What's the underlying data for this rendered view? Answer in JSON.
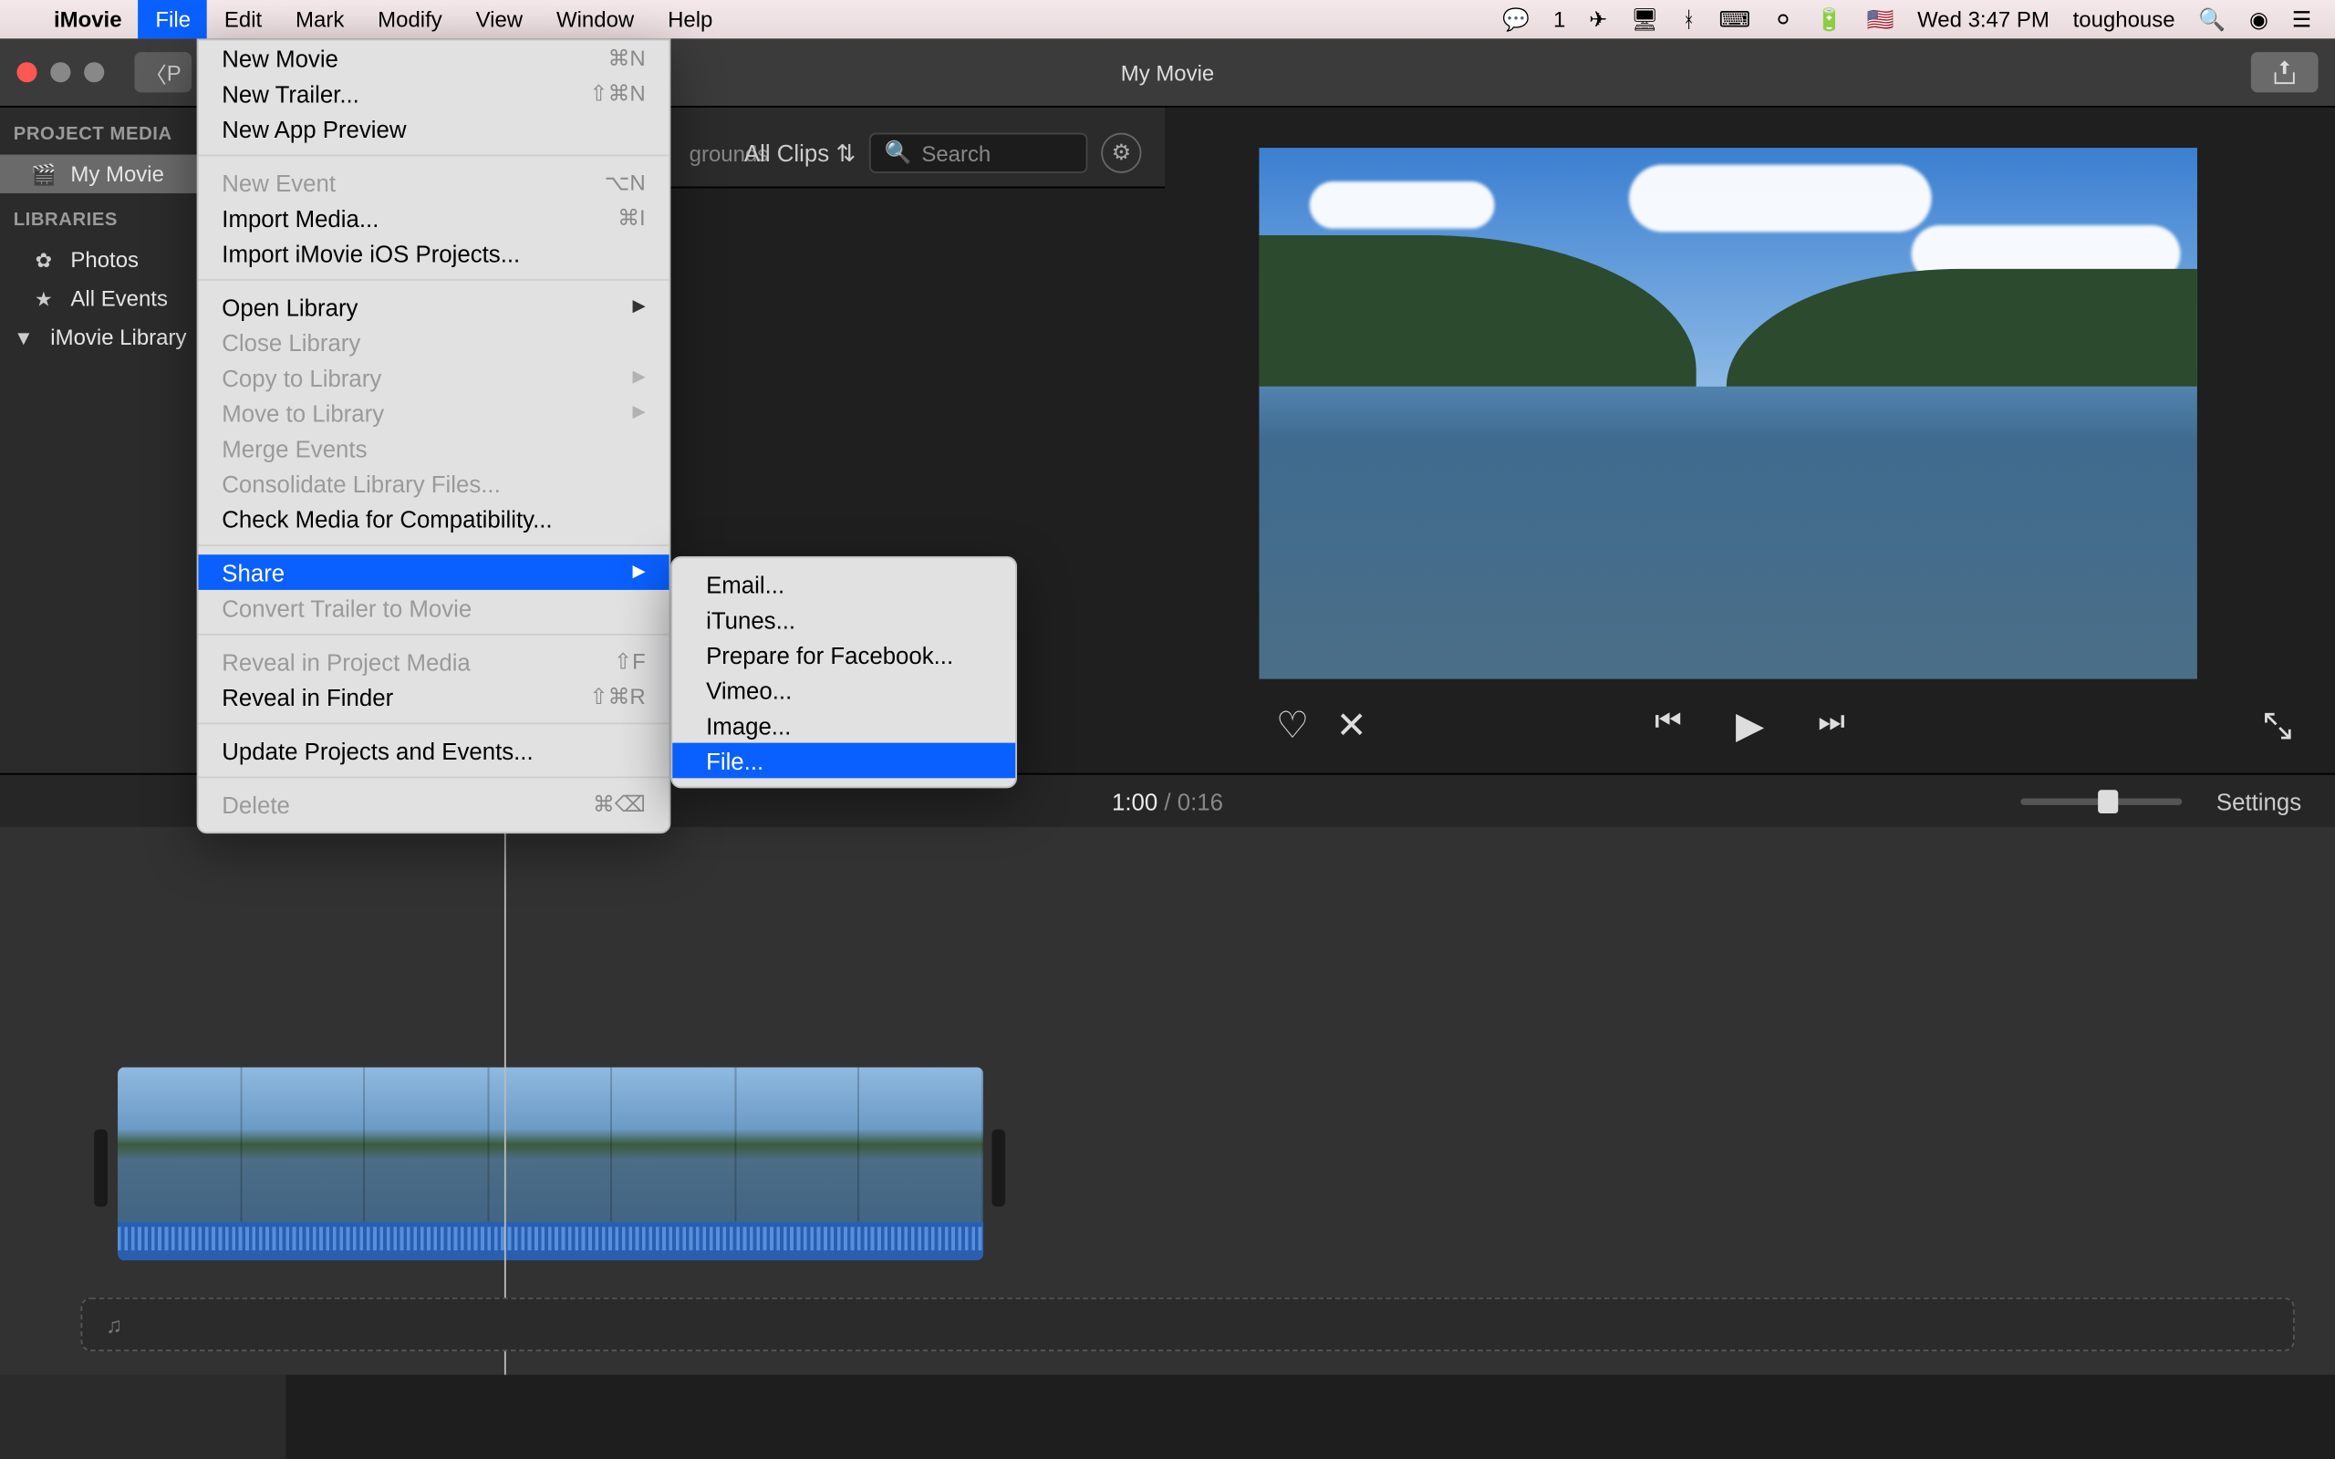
{
  "menubar": {
    "app": "iMovie",
    "items": [
      "File",
      "Edit",
      "Mark",
      "Modify",
      "View",
      "Window",
      "Help"
    ],
    "open_index": 0,
    "right": {
      "wechat_badge": "1",
      "clock": "Wed 3:47 PM",
      "user": "toughouse"
    }
  },
  "window": {
    "title": "My Movie",
    "back_label": "P"
  },
  "sidebar": {
    "headers": {
      "project": "PROJECT MEDIA",
      "libraries": "LIBRARIES"
    },
    "project_item": "My Movie",
    "lib_photos": "Photos",
    "lib_all_events": "All Events",
    "lib_imovie": "iMovie Library"
  },
  "browserbar": {
    "peek_text": "grounds",
    "peek_text2": "",
    "filter": "All Clips",
    "search_placeholder": "Search"
  },
  "viewer": {
    "like": "♡",
    "reject": "✕",
    "prev": "⏮",
    "play": "▶",
    "next": "⏭"
  },
  "timecode": {
    "current": "1:00",
    "sep": "/",
    "total": "0:16",
    "settings": "Settings"
  },
  "file_menu": {
    "g1": [
      {
        "label": "New Movie",
        "sc": "⌘N"
      },
      {
        "label": "New Trailer...",
        "sc": "⇧⌘N"
      },
      {
        "label": "New App Preview",
        "sc": ""
      }
    ],
    "g2": [
      {
        "label": "New Event",
        "sc": "⌥N",
        "disabled": true
      },
      {
        "label": "Import Media...",
        "sc": "⌘I"
      },
      {
        "label": "Import iMovie iOS Projects...",
        "sc": ""
      }
    ],
    "g3": [
      {
        "label": "Open Library",
        "arrow": true
      },
      {
        "label": "Close Library",
        "disabled": true
      },
      {
        "label": "Copy to Library",
        "arrow": true,
        "disabled": true
      },
      {
        "label": "Move to Library",
        "arrow": true,
        "disabled": true
      },
      {
        "label": "Merge Events",
        "disabled": true
      },
      {
        "label": "Consolidate Library Files...",
        "disabled": true
      },
      {
        "label": "Check Media for Compatibility..."
      }
    ],
    "g4": [
      {
        "label": "Share",
        "arrow": true,
        "selected": true
      },
      {
        "label": "Convert Trailer to Movie",
        "disabled": true
      }
    ],
    "g5": [
      {
        "label": "Reveal in Project Media",
        "sc": "⇧F",
        "disabled": true
      },
      {
        "label": "Reveal in Finder",
        "sc": "⇧⌘R"
      }
    ],
    "g6": [
      {
        "label": "Update Projects and Events..."
      }
    ],
    "g7": [
      {
        "label": "Delete",
        "sc": "⌘⌫",
        "disabled": true
      }
    ]
  },
  "share_submenu": [
    {
      "label": "Email..."
    },
    {
      "label": "iTunes..."
    },
    {
      "label": "Prepare for Facebook..."
    },
    {
      "label": "Vimeo..."
    },
    {
      "label": "Image..."
    },
    {
      "label": "File...",
      "selected": true
    }
  ]
}
